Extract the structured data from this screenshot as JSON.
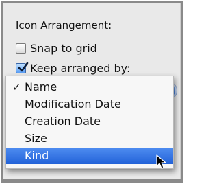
{
  "section": {
    "title": "Icon Arrangement:"
  },
  "options": [
    {
      "label": "Snap to grid",
      "checked": false
    },
    {
      "label": "Keep arranged by:",
      "checked": true
    }
  ],
  "menu": {
    "items": [
      {
        "label": "Name",
        "checked": true,
        "selected": false
      },
      {
        "label": "Modification Date",
        "checked": false,
        "selected": false
      },
      {
        "label": "Creation Date",
        "checked": false,
        "selected": false
      },
      {
        "label": "Size",
        "checked": false,
        "selected": false
      },
      {
        "label": "Kind",
        "checked": false,
        "selected": true
      }
    ],
    "check_glyph": "✓"
  },
  "colors": {
    "selection": "#2f6fe0",
    "panel": "#e9e9e9"
  },
  "icons": {
    "checkbox_mark": "checkmark-icon",
    "cursor": "pointer-arrow-icon"
  }
}
